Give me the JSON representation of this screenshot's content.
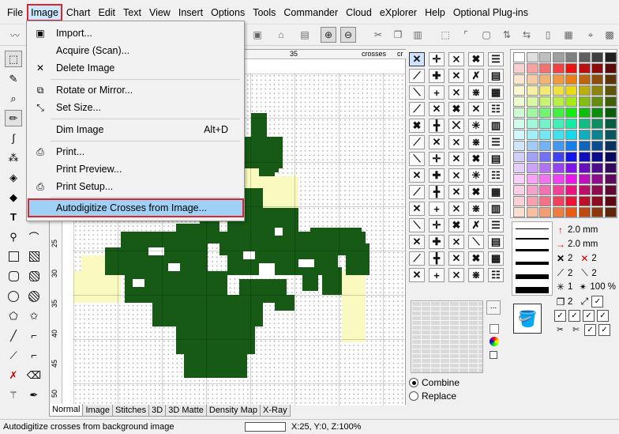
{
  "menubar": {
    "items": [
      "File",
      "Image",
      "Chart",
      "Edit",
      "Text",
      "View",
      "Insert",
      "Options",
      "Tools",
      "Commander",
      "Cloud",
      "eXplorer",
      "Help",
      "Optional Plug-ins"
    ],
    "active": "Image"
  },
  "image_menu": {
    "items": [
      {
        "label": "Import...",
        "icon": "import-icon",
        "shortcut": ""
      },
      {
        "label": "Acquire (Scan)...",
        "icon": "",
        "shortcut": ""
      },
      {
        "label": "Delete Image",
        "icon": "close-icon",
        "shortcut": ""
      },
      {
        "label": "Rotate or Mirror...",
        "icon": "rotate-icon",
        "shortcut": ""
      },
      {
        "label": "Set Size...",
        "icon": "resize-icon",
        "shortcut": ""
      },
      {
        "label": "Dim Image",
        "icon": "",
        "shortcut": "Alt+D"
      },
      {
        "label": "Print...",
        "icon": "printer-icon",
        "shortcut": ""
      },
      {
        "label": "Print Preview...",
        "icon": "",
        "shortcut": ""
      },
      {
        "label": "Print Setup...",
        "icon": "printer-setup-icon",
        "shortcut": ""
      },
      {
        "label": "Autodigitize Crosses from Image...",
        "icon": "",
        "shortcut": ""
      }
    ],
    "highlighted": "Autodigitize Crosses from Image..."
  },
  "ruler": {
    "top_labels": [
      "35",
      "crosses",
      "cr"
    ],
    "left_labels": [
      "25",
      "30",
      "35",
      "40",
      "45",
      "50"
    ]
  },
  "tabs": [
    "Normal",
    "Image",
    "Stitches",
    "3D",
    "3D Matte",
    "Density Map",
    "X-Ray"
  ],
  "active_tab": "Normal",
  "side_panel": {
    "line_width_1": "2.0 mm",
    "line_width_2": "2.0 mm",
    "count_a": "2",
    "count_b": "2",
    "count_c": "2",
    "count_d": "2",
    "count_e": "1",
    "zoom_percent": "100 %",
    "count_f": "2",
    "more_button": "...",
    "combine_label": "Combine",
    "replace_label": "Replace"
  },
  "status": {
    "message": "Autodigitize crosses from background image",
    "coordinates": "X:25, Y:0, Z:100%"
  },
  "colors": {
    "dark_green": "#165a16",
    "light_yellow": "#fafac0",
    "highlight_red": "#e0242b",
    "menu_highlight": "#9fd0f5"
  }
}
